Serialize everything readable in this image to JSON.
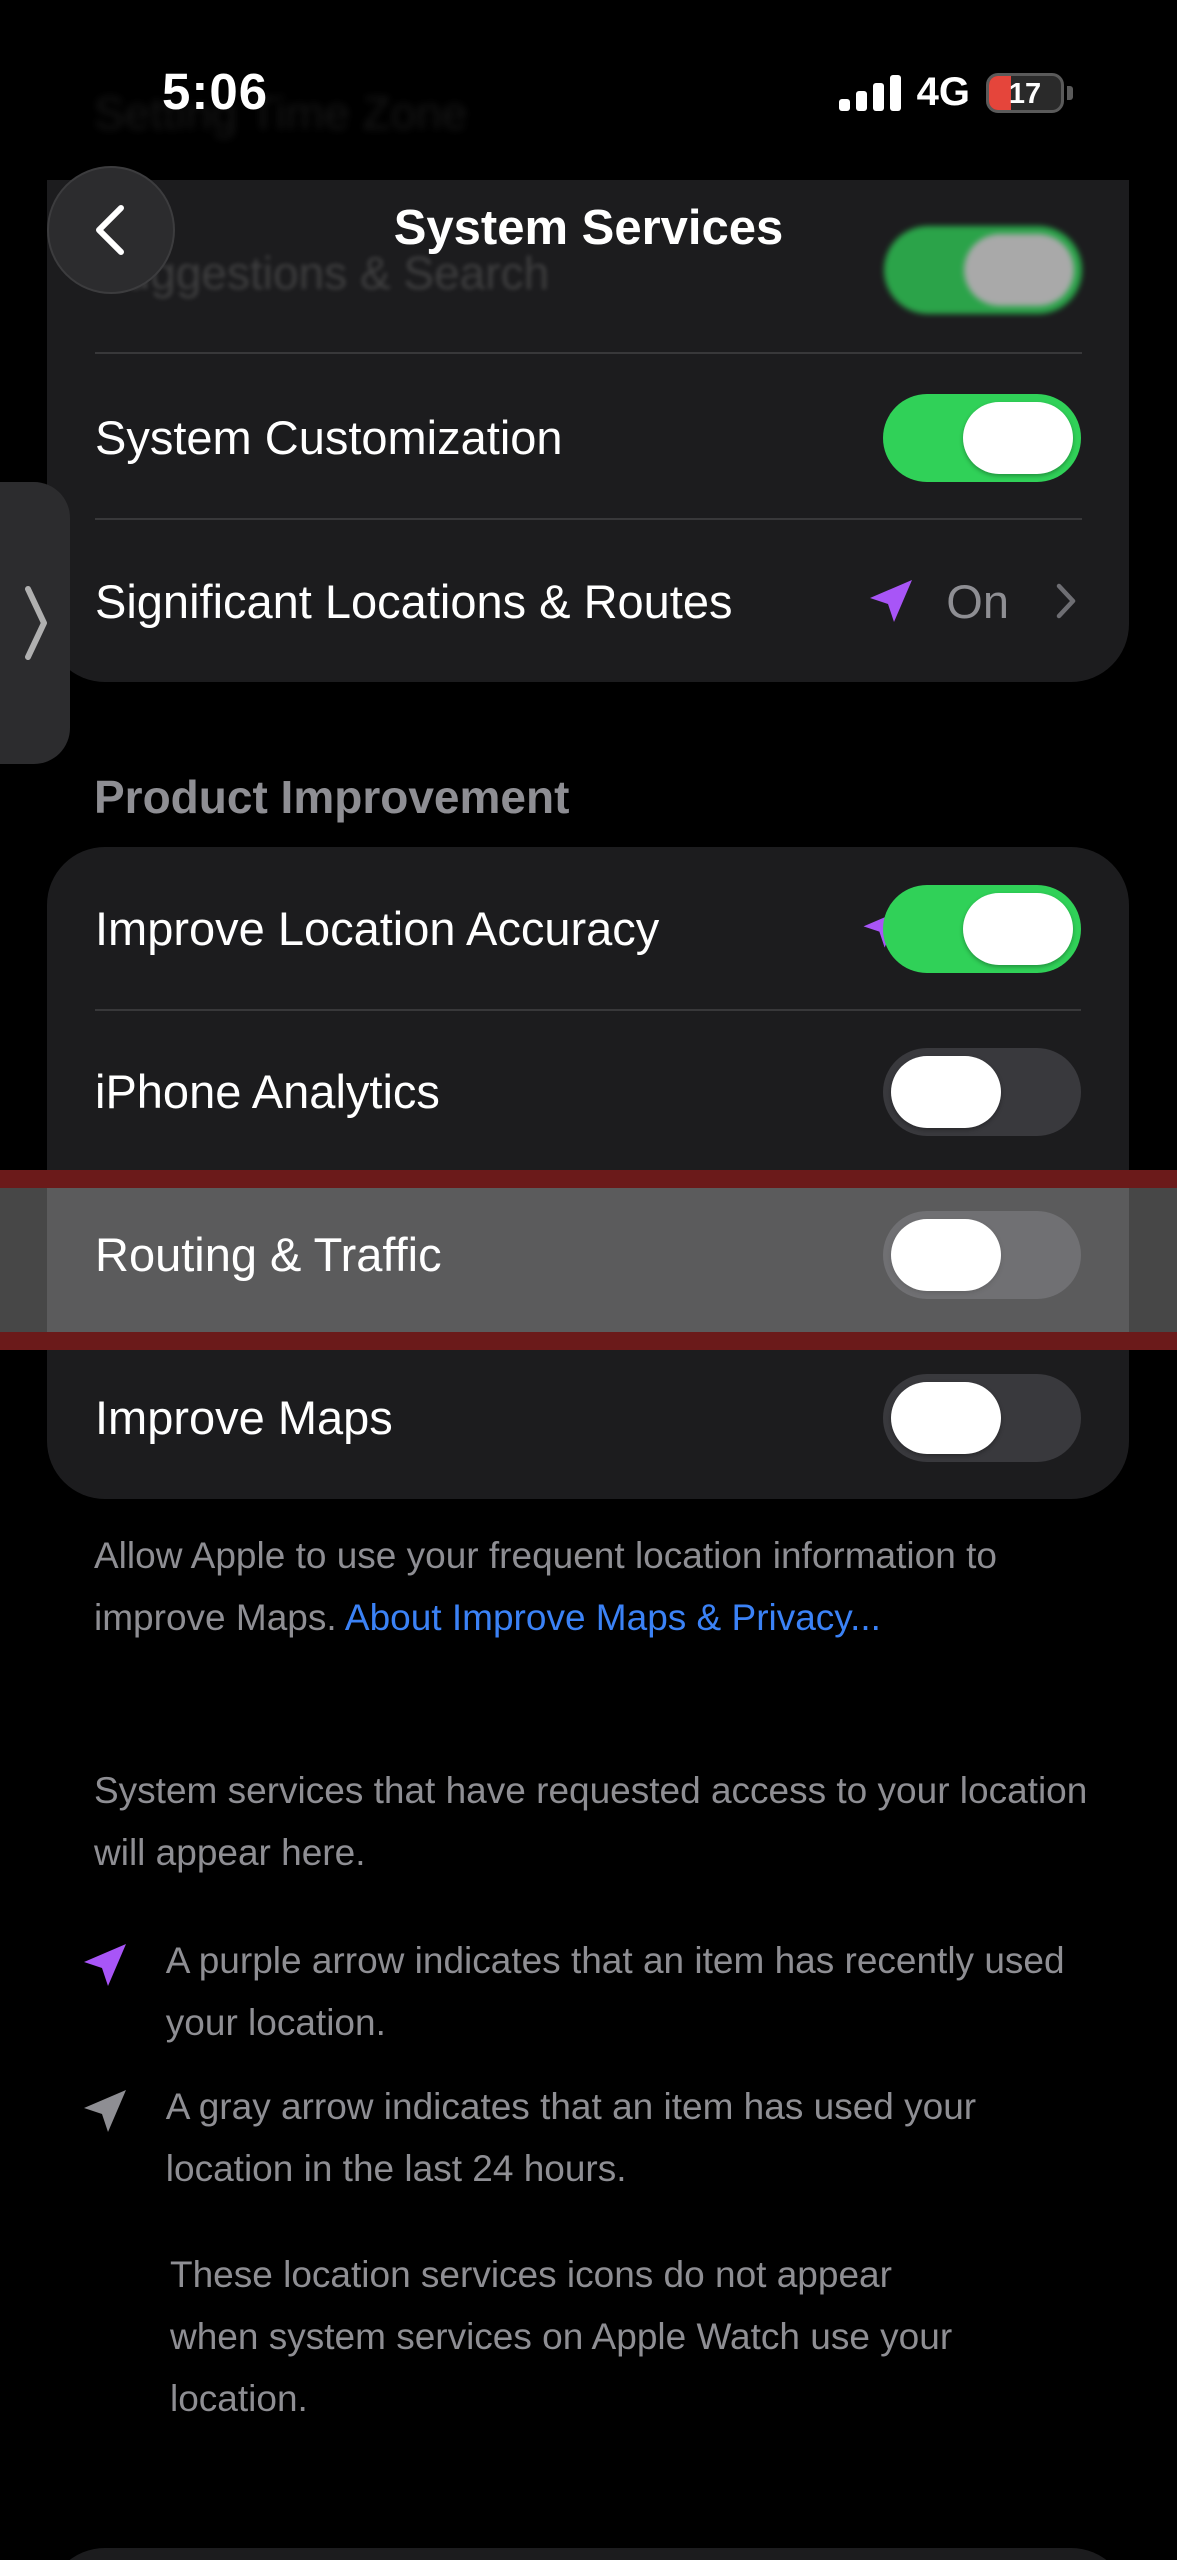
{
  "status_bar": {
    "time": "5:06",
    "network": "4G",
    "battery": "17",
    "battery_color": "#e5453b"
  },
  "nav": {
    "title": "System Services",
    "back_icon": "chevron-left-icon"
  },
  "scrolled_under": {
    "row_label": "Suggestions & Search",
    "row_above_label": "Setting Time Zone"
  },
  "group1": {
    "rows": [
      {
        "label": "System Customization",
        "toggle": true
      },
      {
        "label": "Significant Locations & Routes",
        "value": "On",
        "icon": "purple-location-arrow-icon"
      }
    ]
  },
  "product_improvement": {
    "header": "Product Improvement",
    "rows": [
      {
        "label": "Improve Location Accuracy",
        "toggle": true,
        "icon": "purple-location-arrow-icon"
      },
      {
        "label": "iPhone Analytics",
        "toggle": false
      },
      {
        "label": "Routing & Traffic",
        "toggle": false
      },
      {
        "label": "Improve Maps",
        "toggle": false
      }
    ]
  },
  "maps_footer": {
    "text": "Allow Apple to use your frequent location information to improve Maps.",
    "link": "About Improve Maps & Privacy..."
  },
  "info": {
    "intro": "System services that have requested access to your location will appear here.",
    "purple_arrow": "A purple arrow indicates that an item has recently used your location.",
    "gray_arrow": "A gray arrow indicates that an item has used your location in the last 24 hours.",
    "watch_note": "These location services icons do not appear when system services on Apple Watch use your location."
  },
  "colors": {
    "accent_green": "#30d158",
    "accent_purple": "#a855f7",
    "link_blue": "#3b82f6",
    "highlight_border": "#6b1a1a"
  }
}
